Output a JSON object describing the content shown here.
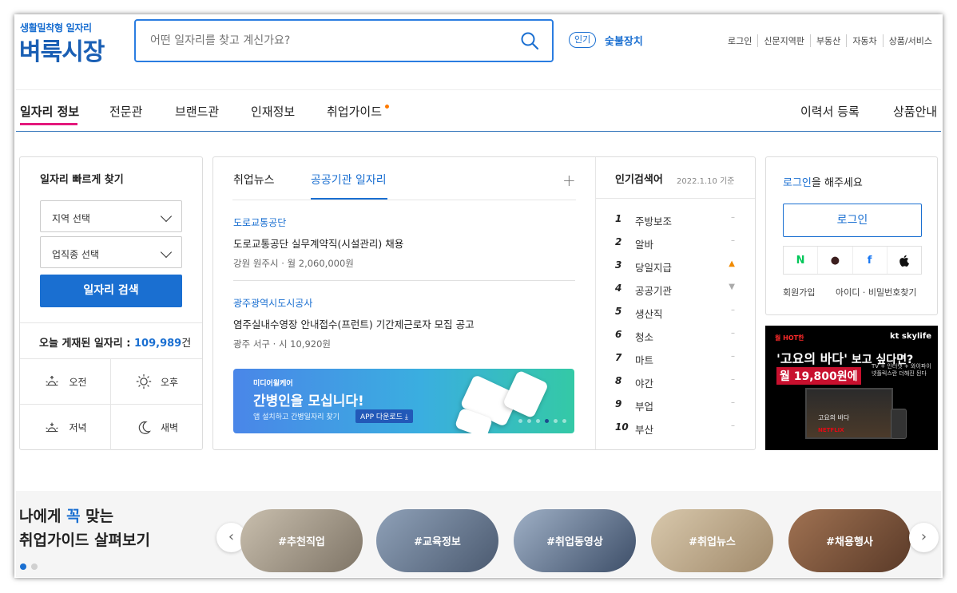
{
  "header": {
    "logo_sub": "생활밀착형 일자리",
    "logo": "벼룩시장",
    "search_placeholder": "어떤 일자리를 찾고 계신가요?",
    "hot_badge": "인기",
    "hot_word": "숯불장치",
    "top_links": [
      "로그인",
      "신문지역판",
      "부동산",
      "자동차",
      "상품/서비스"
    ]
  },
  "nav": {
    "items": [
      "일자리 정보",
      "전문관",
      "브랜드관",
      "인재정보",
      "취업가이드"
    ],
    "right": [
      "이력서 등록",
      "상품안내"
    ]
  },
  "quick": {
    "title": "일자리 빠르게 찾기",
    "region": "지역 선택",
    "category": "업직종 선택",
    "button": "일자리 검색",
    "count_label": "오늘 게재된 일자리 :",
    "count": "109,989",
    "count_unit": "건",
    "times": [
      "오전",
      "오후",
      "저녁",
      "새벽"
    ]
  },
  "news": {
    "tabs": [
      "취업뉴스",
      "공공기관 일자리"
    ],
    "plus": "+",
    "items": [
      {
        "org": "도로교통공단",
        "title": "도로교통공단 실무계약직(시설관리) 채용",
        "meta": "강원 원주시 · 월 2,060,000원"
      },
      {
        "org": "광주광역시도시공사",
        "title": "염주실내수영장 안내접수(프런트) 기간제근로자 모집 공고",
        "meta": "광주 서구 · 시 10,920원"
      }
    ],
    "banner": {
      "tag": "미디어윌케어",
      "title": "간병인을 모십니다!",
      "desc": "앱 설치하고 간병일자리 찾기",
      "app_btn": "APP 다운로드 ⤓"
    }
  },
  "ranking": {
    "title": "인기검색어",
    "date": "2022.1.10 기준",
    "items": [
      {
        "rank": "1",
        "word": "주방보조",
        "trend": "–"
      },
      {
        "rank": "2",
        "word": "알바",
        "trend": "–"
      },
      {
        "rank": "3",
        "word": "당일지급",
        "trend": "▲"
      },
      {
        "rank": "4",
        "word": "공공기관",
        "trend": "▼"
      },
      {
        "rank": "5",
        "word": "생산직",
        "trend": "–"
      },
      {
        "rank": "6",
        "word": "청소",
        "trend": "–"
      },
      {
        "rank": "7",
        "word": "마트",
        "trend": "–"
      },
      {
        "rank": "8",
        "word": "야간",
        "trend": "–"
      },
      {
        "rank": "9",
        "word": "부업",
        "trend": "–"
      },
      {
        "rank": "10",
        "word": "부산",
        "trend": "–"
      }
    ]
  },
  "login": {
    "msg_hl": "로그인",
    "msg_rest": "을 해주세요",
    "button": "로그인",
    "social": [
      "N",
      "●",
      "f",
      ""
    ],
    "signup": "회원가입",
    "find": "아이디 · 비밀번호찾기"
  },
  "ad": {
    "tag": "월 HOT한",
    "brand": "kt skylife",
    "headline1": "'고요의 바다'",
    "headline2": "보고 싶다면?",
    "price": "월 19,800원에",
    "sub": "TV + 인터넷 + 와이파이 넷플릭스란 더해진 된다",
    "tv_title": "고요의 바다",
    "tv_logo": "NETFLIX"
  },
  "bottom": {
    "title1_a": "나에게 ",
    "title1_b": "꼭",
    "title1_c": " 맞는",
    "title2": "취업가이드 살펴보기",
    "pills": [
      "#추천직업",
      "#교육정보",
      "#취업동영상",
      "#취업뉴스",
      "#채용행사"
    ],
    "prev": "‹",
    "next": "›"
  },
  "colors": {
    "accent": "#1a6fd1",
    "nav_underline": "#e4197c",
    "up": "#f08a00"
  }
}
